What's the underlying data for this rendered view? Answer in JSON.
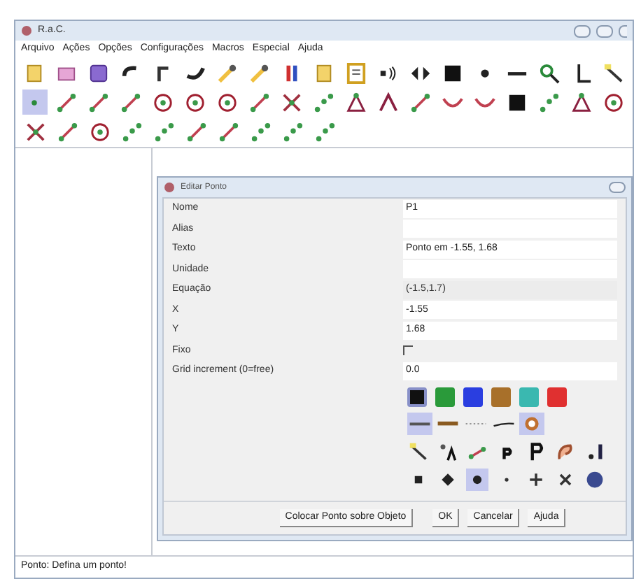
{
  "window": {
    "title": "R.a.C."
  },
  "menu": [
    "Arquivo",
    "Ações",
    "Opções",
    "Configurações",
    "Macros",
    "Especial",
    "Ajuda"
  ],
  "toolbar": [
    [
      {
        "kind": "doc",
        "selected": false
      },
      {
        "kind": "folder",
        "selected": false
      },
      {
        "kind": "image",
        "selected": false
      },
      {
        "kind": "undo",
        "selected": false
      },
      {
        "kind": "hook",
        "selected": false
      },
      {
        "kind": "redo",
        "selected": false
      },
      {
        "kind": "wrench",
        "selected": false
      },
      {
        "kind": "wrench",
        "selected": false
      },
      {
        "kind": "sort",
        "selected": false
      },
      {
        "kind": "doc",
        "selected": false
      },
      {
        "kind": "clipboard",
        "selected": false
      },
      {
        "kind": "speaker",
        "selected": false
      },
      {
        "kind": "arrows",
        "selected": false
      },
      {
        "kind": "square",
        "selected": false
      },
      {
        "kind": "dot",
        "selected": false
      },
      {
        "kind": "line",
        "selected": false
      },
      {
        "kind": "zoom",
        "selected": false
      },
      {
        "kind": "axes",
        "selected": false
      },
      {
        "kind": "pencil",
        "selected": false
      }
    ],
    [
      {
        "kind": "point",
        "selected": true
      },
      {
        "kind": "segment",
        "selected": false
      },
      {
        "kind": "segment",
        "selected": false
      },
      {
        "kind": "segment",
        "selected": false
      },
      {
        "kind": "circle",
        "selected": false
      },
      {
        "kind": "circle",
        "selected": false
      },
      {
        "kind": "circle",
        "selected": false
      },
      {
        "kind": "segment",
        "selected": false
      },
      {
        "kind": "cross",
        "selected": false
      },
      {
        "kind": "dots",
        "selected": false
      },
      {
        "kind": "triangle",
        "selected": false
      },
      {
        "kind": "angle",
        "selected": false
      },
      {
        "kind": "segment",
        "selected": false
      },
      {
        "kind": "curve",
        "selected": false
      },
      {
        "kind": "curve",
        "selected": false
      },
      {
        "kind": "square",
        "selected": false
      },
      {
        "kind": "dots",
        "selected": false
      },
      {
        "kind": "triangle",
        "selected": false
      },
      {
        "kind": "circle",
        "selected": false
      }
    ],
    [
      {
        "kind": "cross",
        "selected": false
      },
      {
        "kind": "segment",
        "selected": false
      },
      {
        "kind": "circle",
        "selected": false
      },
      {
        "kind": "dots",
        "selected": false
      },
      {
        "kind": "dots",
        "selected": false
      },
      {
        "kind": "segment",
        "selected": false
      },
      {
        "kind": "segment",
        "selected": false
      },
      {
        "kind": "dots",
        "selected": false
      },
      {
        "kind": "dots",
        "selected": false
      },
      {
        "kind": "dots",
        "selected": false
      }
    ]
  ],
  "dialog": {
    "title": "Editar Ponto",
    "fields": [
      {
        "label": "Nome",
        "kind": "text",
        "value": "P1"
      },
      {
        "label": "Alias",
        "kind": "text"
      },
      {
        "label": "Texto",
        "kind": "text",
        "value": "Ponto em -1.55, 1.68"
      },
      {
        "label": "Unidade",
        "kind": "text"
      },
      {
        "label": "Equação",
        "kind": "readonly",
        "value": "(-1.5,1.7)"
      },
      {
        "label": "X",
        "kind": "text",
        "value": "-1.55"
      },
      {
        "label": "Y",
        "kind": "text",
        "value": "1.68"
      },
      {
        "label": "Fixo",
        "kind": "checkbox",
        "checked": false
      },
      {
        "label": "Grid increment (0=free)",
        "kind": "text",
        "value": "0.0"
      }
    ],
    "colors": [
      {
        "color": "#111111",
        "selected": true
      },
      {
        "color": "#2a9a3a",
        "selected": false
      },
      {
        "color": "#2a3ee0",
        "selected": false
      },
      {
        "color": "#a8702a",
        "selected": false
      },
      {
        "color": "#3ab8b0",
        "selected": false
      },
      {
        "color": "#e03030",
        "selected": false
      }
    ],
    "line_styles": [
      {
        "kind": "normal",
        "selected": true
      },
      {
        "kind": "thick",
        "selected": false
      },
      {
        "kind": "dotted",
        "selected": false
      },
      {
        "kind": "thin",
        "selected": false
      },
      {
        "kind": "ring",
        "selected": true
      }
    ],
    "options": [
      {
        "kind": "pencil",
        "selected": false
      },
      {
        "kind": "label",
        "selected": false
      },
      {
        "kind": "value",
        "selected": false
      },
      {
        "kind": "small-p",
        "selected": false
      },
      {
        "kind": "big-p",
        "selected": false
      },
      {
        "kind": "style",
        "selected": false
      },
      {
        "kind": "bars",
        "selected": false
      }
    ],
    "point_shapes": [
      {
        "kind": "square",
        "selected": false
      },
      {
        "kind": "diamond",
        "selected": false
      },
      {
        "kind": "circle",
        "selected": true
      },
      {
        "kind": "dot",
        "selected": false
      },
      {
        "kind": "plus",
        "selected": false
      },
      {
        "kind": "cross",
        "selected": false
      },
      {
        "kind": "ball",
        "selected": false
      }
    ],
    "buttons": [
      "Colocar Ponto sobre Objeto",
      "OK",
      "Cancelar",
      "Ajuda"
    ]
  },
  "status_bar": "Ponto: Defina um ponto!"
}
